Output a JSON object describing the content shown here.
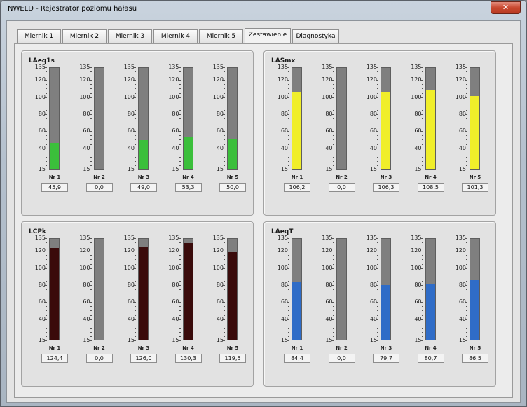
{
  "window": {
    "title": "NWELD - Rejestrator poziomu hałasu",
    "close_label": "✕"
  },
  "tabs": [
    "Miernik 1",
    "Miernik 2",
    "Miernik 3",
    "Miernik 4",
    "Miernik 5",
    "Zestawienie",
    "Diagnostyka"
  ],
  "active_tab": "Zestawienie",
  "scale": {
    "min": 15,
    "max": 135,
    "labels": [
      "135",
      "120",
      "100",
      "80",
      "60",
      "40",
      "15"
    ]
  },
  "panels": [
    {
      "title": "LAeq1s",
      "color": "#3bbf3b",
      "meters": [
        {
          "name": "Nr 1",
          "value": "45,9"
        },
        {
          "name": "Nr 2",
          "value": "0,0"
        },
        {
          "name": "Nr 3",
          "value": "49,0"
        },
        {
          "name": "Nr 4",
          "value": "53,3"
        },
        {
          "name": "Nr 5",
          "value": "50,0"
        }
      ]
    },
    {
      "title": "LASmx",
      "color": "#f0ee2a",
      "meters": [
        {
          "name": "Nr 1",
          "value": "106,2"
        },
        {
          "name": "Nr 2",
          "value": "0,0"
        },
        {
          "name": "Nr 3",
          "value": "106,3"
        },
        {
          "name": "Nr 4",
          "value": "108,5"
        },
        {
          "name": "Nr 5",
          "value": "101,3"
        }
      ]
    },
    {
      "title": "LCPk",
      "color": "#3a0b0b",
      "meters": [
        {
          "name": "Nr 1",
          "value": "124,4"
        },
        {
          "name": "Nr 2",
          "value": "0,0"
        },
        {
          "name": "Nr 3",
          "value": "126,0"
        },
        {
          "name": "Nr 4",
          "value": "130,3"
        },
        {
          "name": "Nr 5",
          "value": "119,5"
        }
      ]
    },
    {
      "title": "LAeqT",
      "color": "#2f6cc7",
      "meters": [
        {
          "name": "Nr 1",
          "value": "84,4"
        },
        {
          "name": "Nr 2",
          "value": "0,0"
        },
        {
          "name": "Nr 3",
          "value": "79,7"
        },
        {
          "name": "Nr 4",
          "value": "80,7"
        },
        {
          "name": "Nr 5",
          "value": "86,5"
        }
      ]
    }
  ]
}
